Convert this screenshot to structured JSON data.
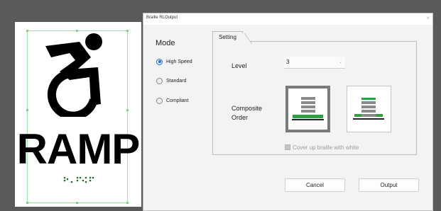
{
  "preview": {
    "sign_text": "RAMP",
    "icon": "accessible-wheelchair-icon",
    "braille": "braille-dots"
  },
  "dialog": {
    "title": "Braille RLOutput",
    "close_icon": "×"
  },
  "mode": {
    "title": "Mode",
    "options": [
      {
        "label": "High Speed",
        "checked": true
      },
      {
        "label": "Standard",
        "checked": false
      },
      {
        "label": "Compliant",
        "checked": false
      }
    ]
  },
  "setting": {
    "tab_label": "Setting",
    "level_label": "Level",
    "level_value": "3",
    "level_chevron": "⌄",
    "composite_order_label_line1": "Composite",
    "composite_order_label_line2": "Order",
    "order_options": [
      {
        "name": "composite-order-option-1",
        "selected": true
      },
      {
        "name": "composite-order-option-2",
        "selected": false
      }
    ],
    "cover_label": "Cover up braille with white",
    "cover_checked": false
  },
  "buttons": {
    "cancel": "Cancel",
    "output": "Output"
  },
  "colors": {
    "green": "#2ea043",
    "stack_gray": "#8a8a8a",
    "selected_border": "#7a7a7a",
    "radio_accent": "#2d6fbf"
  }
}
